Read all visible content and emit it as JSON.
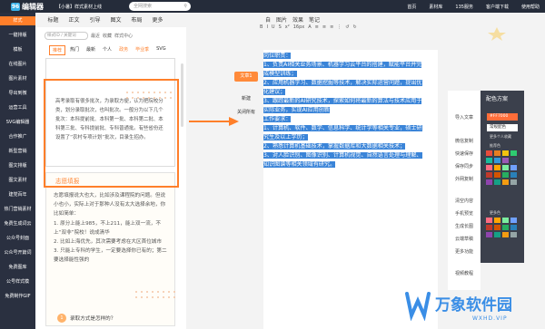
{
  "topbar": {
    "logo_badge": "96",
    "logo_text": "编辑器",
    "notice": "【小暑】样式素材上线",
    "search_placeholder": "全网搜索",
    "nav": [
      "首页",
      "素材库",
      "135服务",
      "客户端下载",
      "使用帮助"
    ]
  },
  "leftnav": [
    "样式",
    "一键排版",
    "模板",
    "在线图片",
    "图片素材",
    "导出到微",
    "运营工具",
    "SVG编辑器",
    "合作推广",
    "新型营销",
    "图文排版",
    "图文素材",
    "建党百年",
    "热门营销素材",
    "免费生成词云",
    "公众号封面",
    "公众号开篇词",
    "免费图库",
    "公号样式模",
    "免费制作GIF"
  ],
  "category_tabs": [
    "标题",
    "正文",
    "引导",
    "图文",
    "布局",
    "更多"
  ],
  "panel": {
    "search_placeholder": "样式ID / 关键词",
    "links": [
      "最近",
      "收藏",
      "样式中心"
    ],
    "filters": [
      "推荐",
      "热门",
      "最新",
      "个人",
      "政务",
      "毕业季",
      "SVG"
    ],
    "style_a_text": "高考录取有很多批次，为录取方便，认为把院校分类，划分录取批次，也叫批次。一般分为以下几个批次：本科提前批、本科第一批、本科第二批、本科第三批、专科提前批、专科普通批。有些省份还设置了“农村专项计划”批次，目录生招办。",
    "style_b_title": "志愿填报",
    "style_b_text": [
      "志愿填报说大也大，比如涉及课程院的问题。但说小也小，实际上对于那种人没有太大选择余地，你比如简单：",
      "1. 原分上能上985，不上211，能上双一流，不上“双非”院校！说成清华",
      "2. 比如上海优先，其次需要考虑在大区首位城市",
      "3. 只能上专科的学生，一定要选择你已有的；第二要选择能性强的"
    ],
    "style_b_sub": "录取方式是怎样的？",
    "style_b_num": "1"
  },
  "editor": {
    "toolbar_tabs": [
      "自",
      "图片",
      "效果",
      "笔记"
    ],
    "toolbar2": [
      "B",
      "I",
      "U",
      "S",
      "x²",
      "16px",
      "A",
      "≡",
      "≡",
      "≡",
      "⋮",
      "↺",
      "↻"
    ],
    "buttons": [
      "文章1",
      "新建",
      "关闭所有"
    ],
    "selected_lines": [
      "岗位职责：",
      "1、负责AI相关业务场景、机器学习云平台的搭建，赋能平台并完",
      "成模型训练；",
      "2、应用机器学习、数据挖掘等技术，解决实际运营问题，提出优",
      "化建议；",
      "3、跟踪最新的AI研究技术，探索如何将最新的算法与技术应用于",
      "实际业务，实现AI应用创新",
      "工作要求：",
      "1、计算机、软件、数学、信息科学、统计学等相关专业，硕士研",
      "究生及以上学历；",
      "2、熟悉计算机基础技术，掌握数据库和大数据相关技术；",
      "3、对人脸识别、图像识别、计算机视觉、自然语言处理与理解、",
      "知识图谱等相关领域有研究。"
    ]
  },
  "right_menu": [
    "导入文章",
    "微信复制",
    "快速保存",
    "保存同步",
    "外网复制",
    "清空内容",
    "手机预览",
    "生成长图",
    "云端草稿",
    "更多功能",
    "视频教程"
  ],
  "palette": {
    "title": "配色方案",
    "current": "#FF7000",
    "select": "常规配色",
    "labels": [
      "更多个人收藏",
      "推荐色",
      "更多色"
    ],
    "colors": [
      "#e74c3c",
      "#e67e22",
      "#f1c40f",
      "#2ecc71",
      "#1abc9c",
      "#3498db",
      "#9b59b6",
      "#34495e",
      "#ff6b81",
      "#ffa502",
      "#7bed9f",
      "#70a1ff",
      "#c0392b",
      "#d35400",
      "#27ae60",
      "#2980b9",
      "#8e44ad",
      "#16a085",
      "#f39c12",
      "#95a5a6"
    ],
    "accent": "#ff7f2a"
  },
  "watermark": {
    "brand": "万象软件园",
    "url": "WXHD.VIP"
  }
}
